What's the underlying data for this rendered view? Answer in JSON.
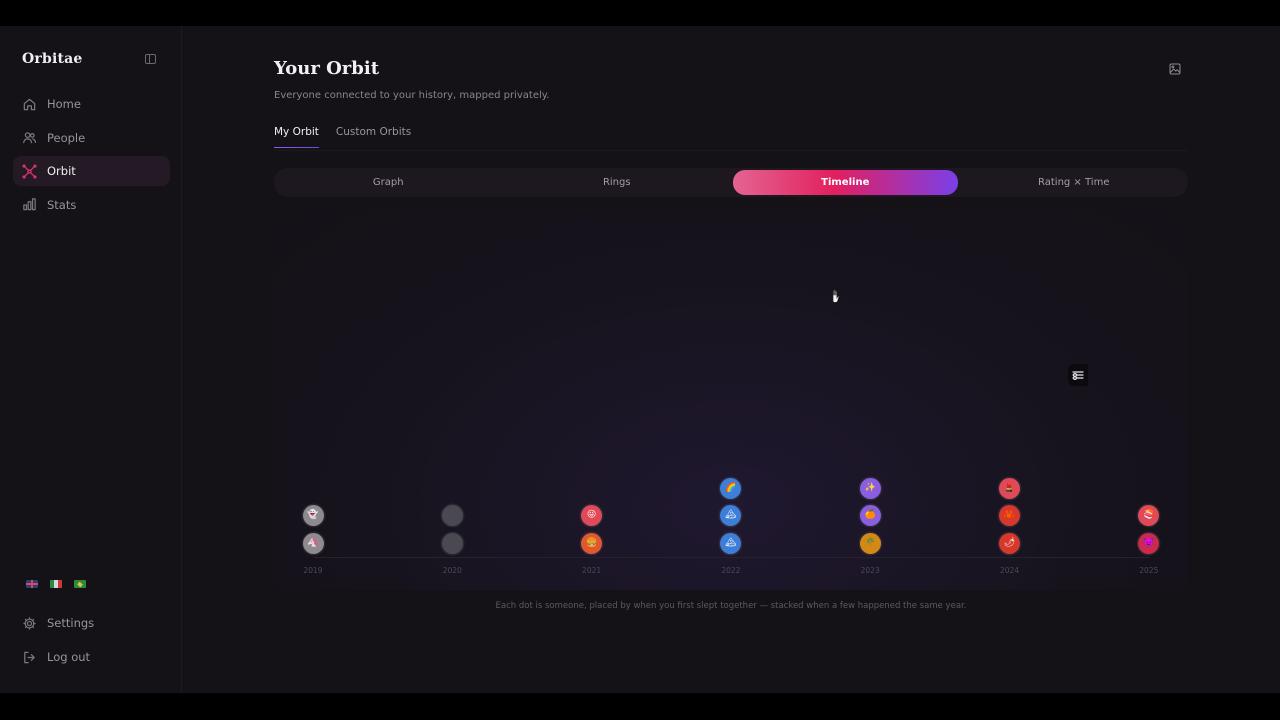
{
  "app": {
    "brand": "Orbitae"
  },
  "sidebar": {
    "items": [
      {
        "label": "Home",
        "icon": "home-icon",
        "active": false
      },
      {
        "label": "People",
        "icon": "people-icon",
        "active": false
      },
      {
        "label": "Orbit",
        "icon": "orbit-icon",
        "active": true
      },
      {
        "label": "Stats",
        "icon": "stats-icon",
        "active": false
      }
    ],
    "bottom": [
      {
        "label": "Settings",
        "icon": "gear-icon"
      },
      {
        "label": "Log out",
        "icon": "logout-icon"
      }
    ]
  },
  "page": {
    "title": "Your Orbit",
    "subtitle": "Everyone connected to your history, mapped privately."
  },
  "tabs": [
    {
      "label": "My Orbit",
      "active": true
    },
    {
      "label": "Custom Orbits",
      "active": false
    }
  ],
  "views": [
    {
      "label": "Graph",
      "active": false
    },
    {
      "label": "Rings",
      "active": false
    },
    {
      "label": "Timeline",
      "active": true
    },
    {
      "label": "Rating × Time",
      "active": false
    }
  ],
  "timeline": {
    "years": [
      "2019",
      "2020",
      "2021",
      "2022",
      "2023",
      "2024",
      "2025"
    ],
    "stacks": [
      {
        "year": "2019",
        "dots": [
          {
            "color": "#8f8a90",
            "emoji": "🦄"
          },
          {
            "color": "#8d898f",
            "emoji": "👻"
          }
        ]
      },
      {
        "year": "2020",
        "dots": [
          {
            "color": "#4a4850",
            "emoji": ""
          },
          {
            "color": "#4a4850",
            "emoji": ""
          }
        ]
      },
      {
        "year": "2021",
        "dots": [
          {
            "color": "#e2582d",
            "emoji": "🍔"
          },
          {
            "color": "#e04a58",
            "emoji": "😜"
          }
        ]
      },
      {
        "year": "2022",
        "dots": [
          {
            "color": "#3c7ed8",
            "emoji": "🏔"
          },
          {
            "color": "#3c7ed8",
            "emoji": "🏔"
          },
          {
            "color": "#3c7ed8",
            "emoji": "🌈"
          }
        ]
      },
      {
        "year": "2023",
        "dots": [
          {
            "color": "#d28a14",
            "emoji": "🌴"
          },
          {
            "color": "#8a5ee0",
            "emoji": "🍊"
          },
          {
            "color": "#8a5ee0",
            "emoji": "✨"
          }
        ]
      },
      {
        "year": "2024",
        "dots": [
          {
            "color": "#d6382c",
            "emoji": "🌶"
          },
          {
            "color": "#d6382c",
            "emoji": "🦀"
          },
          {
            "color": "#e04a58",
            "emoji": "💄"
          }
        ]
      },
      {
        "year": "2025",
        "dots": [
          {
            "color": "#cc2a4c",
            "emoji": "👿"
          },
          {
            "color": "#e04a58",
            "emoji": "🍣"
          }
        ]
      }
    ],
    "caption": "Each dot is someone, placed by when you first slept together — stacked when a few happened the same year."
  },
  "flags": [
    "flag-en-icon",
    "flag-it-icon",
    "flag-br-icon"
  ],
  "colors": {
    "accent_pink": "#e2205f",
    "accent_violet": "#7b3fe8",
    "bg": "#141117"
  }
}
